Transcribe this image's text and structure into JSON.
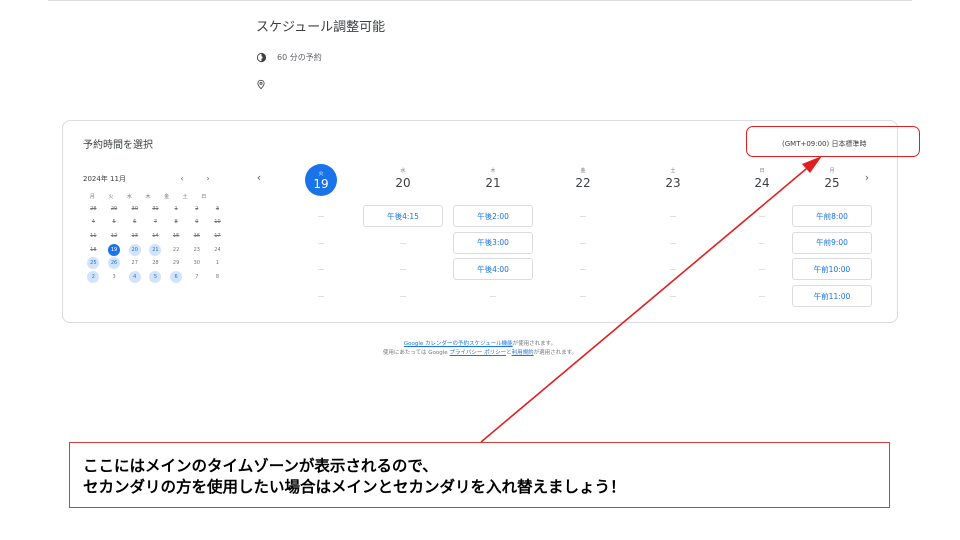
{
  "event": {
    "title": "スケジュール調整可能",
    "duration": "60 分の予約",
    "duration_icon": "timer-icon",
    "location_icon": "location-pin-icon"
  },
  "booking": {
    "heading": "予約時間を選択",
    "timezone": "(GMT+09:00) 日本標準時"
  },
  "mini_calendar": {
    "month": "2024年 11月",
    "prev": "‹",
    "next": "›",
    "weekdays": [
      "月",
      "火",
      "水",
      "木",
      "金",
      "土",
      "日"
    ],
    "days": [
      {
        "d": "28",
        "s": "past"
      },
      {
        "d": "29",
        "s": "past"
      },
      {
        "d": "30",
        "s": "past"
      },
      {
        "d": "31",
        "s": "past"
      },
      {
        "d": "1",
        "s": "past"
      },
      {
        "d": "2",
        "s": "past"
      },
      {
        "d": "3",
        "s": "past"
      },
      {
        "d": "4",
        "s": "past"
      },
      {
        "d": "5",
        "s": "past"
      },
      {
        "d": "6",
        "s": "past"
      },
      {
        "d": "7",
        "s": "past"
      },
      {
        "d": "8",
        "s": "past"
      },
      {
        "d": "9",
        "s": "past"
      },
      {
        "d": "10",
        "s": "past"
      },
      {
        "d": "11",
        "s": "past"
      },
      {
        "d": "12",
        "s": "past"
      },
      {
        "d": "13",
        "s": "past"
      },
      {
        "d": "14",
        "s": "past"
      },
      {
        "d": "15",
        "s": "past"
      },
      {
        "d": "16",
        "s": "past"
      },
      {
        "d": "17",
        "s": "past"
      },
      {
        "d": "18",
        "s": "past"
      },
      {
        "d": "19",
        "s": "sel"
      },
      {
        "d": "20",
        "s": "avail"
      },
      {
        "d": "21",
        "s": "avail"
      },
      {
        "d": "22",
        "s": "none"
      },
      {
        "d": "23",
        "s": "none"
      },
      {
        "d": "24",
        "s": "none"
      },
      {
        "d": "25",
        "s": "avail"
      },
      {
        "d": "26",
        "s": "avail"
      },
      {
        "d": "27",
        "s": "none"
      },
      {
        "d": "28",
        "s": "none"
      },
      {
        "d": "29",
        "s": "none"
      },
      {
        "d": "30",
        "s": "none"
      },
      {
        "d": "1",
        "s": "none"
      },
      {
        "d": "2",
        "s": "avail"
      },
      {
        "d": "3",
        "s": "none"
      },
      {
        "d": "4",
        "s": "avail"
      },
      {
        "d": "5",
        "s": "avail"
      },
      {
        "d": "6",
        "s": "avail"
      },
      {
        "d": "7",
        "s": "none"
      },
      {
        "d": "8",
        "s": "none"
      }
    ]
  },
  "week": {
    "prev": "‹",
    "next": "›",
    "days": [
      {
        "dow": "火",
        "num": "19",
        "today": true,
        "slots": [
          "",
          "",
          "",
          ""
        ]
      },
      {
        "dow": "水",
        "num": "20",
        "today": false,
        "slots": [
          "午後4:15",
          "",
          "",
          ""
        ]
      },
      {
        "dow": "木",
        "num": "21",
        "today": false,
        "slots": [
          "午後2:00",
          "午後3:00",
          "午後4:00",
          ""
        ]
      },
      {
        "dow": "金",
        "num": "22",
        "today": false,
        "slots": [
          "",
          "",
          "",
          ""
        ]
      },
      {
        "dow": "土",
        "num": "23",
        "today": false,
        "slots": [
          "",
          "",
          "",
          ""
        ]
      },
      {
        "dow": "日",
        "num": "24",
        "today": false,
        "slots": [
          "",
          "",
          "",
          ""
        ]
      },
      {
        "dow": "月",
        "num": "25",
        "today": false,
        "slots": [
          "午前8:00",
          "午前9:00",
          "午前10:00",
          "午前11:00"
        ]
      }
    ],
    "empty_mark": "—"
  },
  "footer": {
    "line1_link": "Google カレンダーの予約スケジュール機能",
    "line1_text": "が使用されます。",
    "line2_pre": "使用にあたっては Google ",
    "line2_privacy": "プライバシー ポリシー",
    "line2_and": "と",
    "line2_terms": "利用規約",
    "line2_post": "が適用されます。"
  },
  "annotation": {
    "line1": "ここにはメインのタイムゾーンが表示されるので、",
    "line2": "セカンダリの方を使用したい場合はメインとセカンダリを入れ替えましょう！",
    "color": "#e02020"
  }
}
